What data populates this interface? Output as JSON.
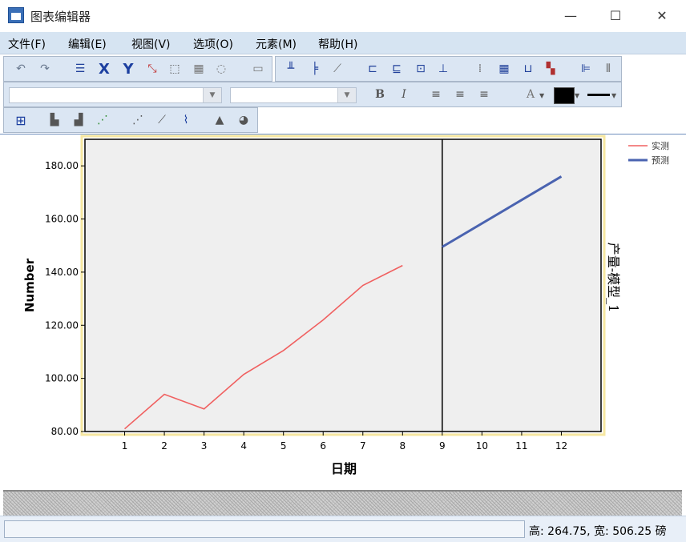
{
  "window": {
    "title": "图表编辑器",
    "minimize": "—",
    "maximize": "☐",
    "close": "✕"
  },
  "menu": [
    {
      "label": "文件(F)"
    },
    {
      "label": "编辑(E)"
    },
    {
      "label": "视图(V)"
    },
    {
      "label": "选项(O)"
    },
    {
      "label": "元素(M)"
    },
    {
      "label": "帮助(H)"
    }
  ],
  "toolbar1": {
    "icons": [
      "undo-icon",
      "redo-icon",
      "properties-icon",
      "x-axis-icon",
      "y-axis-icon",
      "scale-icon",
      "resize-icon",
      "transpose-icon",
      "lasso-icon",
      "hide-icon",
      "y-ref-line-icon",
      "x-ref-line-icon",
      "fit-line-icon",
      "title-icon",
      "footnote-icon",
      "annotation-icon",
      "textbox-icon",
      "grid-icon",
      "table-grid-icon",
      "data-label-icon",
      "legend-icon",
      "bar-order-icon",
      "bar-stack-icon"
    ],
    "x_label": "X",
    "y_label": "Y"
  },
  "toolbar2": {
    "font_combo_value": "",
    "size_combo_value": "",
    "bold_label": "B",
    "italic_label": "I",
    "text_color_label": "A"
  },
  "toolbar3": {
    "icons": [
      "select-icon",
      "bar-chart-icon",
      "stacked-bar-icon",
      "scatter-color-icon",
      "scatter-icon",
      "scatter-fit-icon",
      "line-chart-icon",
      "area-chart-icon",
      "pie-chart-icon"
    ]
  },
  "status": {
    "text": "高: 264.75, 宽: 506.25 磅"
  },
  "chart_data": {
    "type": "line",
    "xlabel": "日期",
    "ylabel": "Number",
    "right_label": "产量-模型_1",
    "xlim": [
      0,
      13
    ],
    "ylim": [
      80,
      190
    ],
    "x_ticks": [
      1,
      2,
      3,
      4,
      5,
      6,
      7,
      8,
      9,
      10,
      11,
      12
    ],
    "y_ticks": [
      "80.00",
      "100.00",
      "120.00",
      "140.00",
      "160.00",
      "180.00"
    ],
    "y_tick_values": [
      80,
      100,
      120,
      140,
      160,
      180
    ],
    "divider_x": 9,
    "series": [
      {
        "name": "实测",
        "color": "#f06060",
        "x": [
          1,
          2,
          3,
          4,
          5,
          6,
          7,
          8
        ],
        "values": [
          81,
          94,
          88.5,
          101.5,
          110.5,
          122,
          135,
          142.5
        ]
      },
      {
        "name": "预测",
        "color": "#4a63b0",
        "x": [
          9,
          12
        ],
        "values": [
          149.5,
          176
        ]
      }
    ],
    "plot_background": "#efefef",
    "highlight_color": "#f6e7a1"
  }
}
